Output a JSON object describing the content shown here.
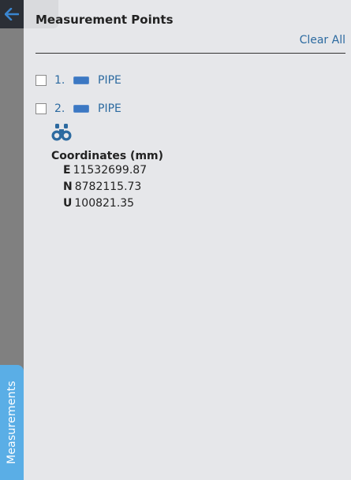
{
  "left_bar": {
    "back_icon": "arrow-left-icon",
    "tab_label": "Measurements"
  },
  "panel": {
    "title": "Measurement Points",
    "clear_all": "Clear All",
    "points": [
      {
        "index": "1.",
        "name": "PIPE",
        "swatch_color": "#3c78c3"
      },
      {
        "index": "2.",
        "name": "PIPE",
        "swatch_color": "#3c78c3"
      }
    ],
    "details": {
      "zoom_icon": "binoculars-icon",
      "heading": "Coordinates (mm)",
      "coords": [
        {
          "axis": "E",
          "value": "11532699.87"
        },
        {
          "axis": "N",
          "value": "8782115.73"
        },
        {
          "axis": "U",
          "value": "100821.35"
        }
      ]
    }
  },
  "colors": {
    "accent": "#2c6aa0",
    "tab": "#5aaee6",
    "background": "#e6e7ea"
  }
}
